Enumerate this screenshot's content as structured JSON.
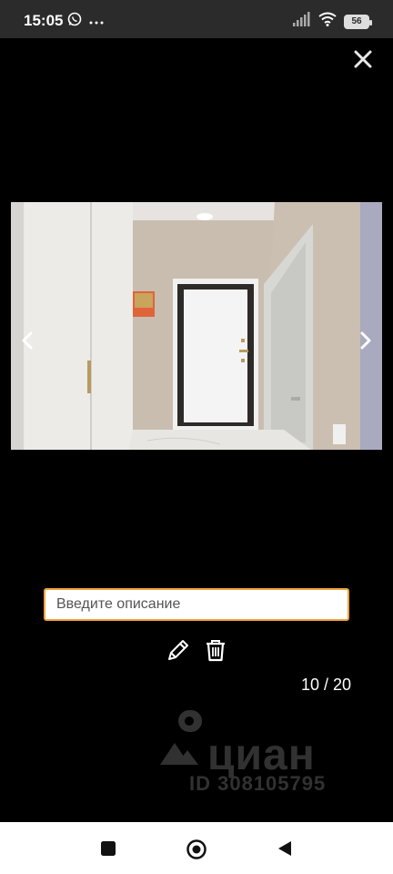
{
  "status_bar": {
    "time": "15:05",
    "battery": "56",
    "icons": [
      "whatsapp-icon",
      "more-notifications-icon",
      "signal-icon",
      "wifi-icon",
      "battery-icon"
    ]
  },
  "viewer": {
    "close_icon": "close-icon",
    "prev_icon": "chevron-left-icon",
    "next_icon": "chevron-right-icon",
    "counter": "10 / 20",
    "current_index": 10,
    "total": 20
  },
  "description": {
    "placeholder": "Введите описание",
    "value": ""
  },
  "actions": {
    "edit_icon": "pencil-icon",
    "delete_icon": "trash-icon"
  },
  "watermark": {
    "brand": "циан",
    "id_text": "ID 308105795"
  },
  "system_nav": {
    "icons": [
      "recents-icon",
      "home-icon",
      "back-icon"
    ]
  },
  "colors": {
    "status_bar_bg": "#2b2b2b",
    "input_border": "#f0a13a",
    "background": "#000000"
  }
}
